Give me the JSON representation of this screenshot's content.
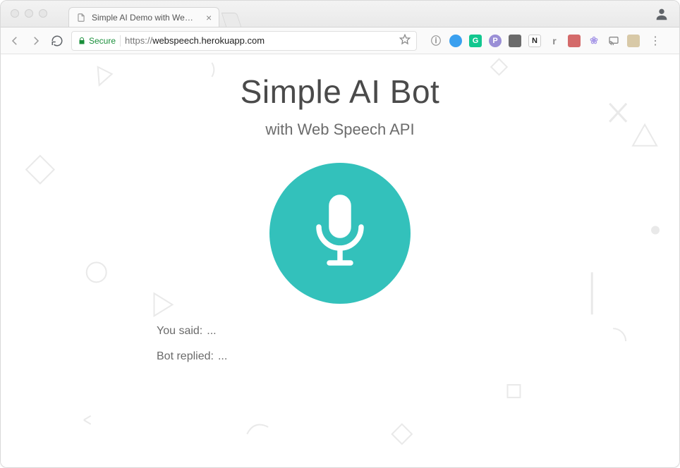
{
  "browser": {
    "tab": {
      "title": "Simple AI Demo with Web Spe"
    },
    "secure_label": "Secure",
    "url": {
      "scheme": "https://",
      "host": "webspeech.herokuapp.com",
      "path": ""
    }
  },
  "page": {
    "title": "Simple AI Bot",
    "subtitle": "with Web Speech API",
    "you_said_label": "You said:",
    "you_said_value": "...",
    "bot_replied_label": "Bot replied:",
    "bot_replied_value": "..."
  },
  "colors": {
    "accent": "#33c1bb",
    "secure_green": "#1a8f3b"
  },
  "ext_icons": [
    {
      "name": "info-icon",
      "bg": "transparent",
      "fg": "#8a8a8a",
      "glyph": "ⓘ"
    },
    {
      "name": "ext-circle-blue",
      "bg": "#3aa0ef",
      "fg": "#fff",
      "glyph": ""
    },
    {
      "name": "ext-grammarly",
      "bg": "#12c78f",
      "fg": "#fff",
      "glyph": "G"
    },
    {
      "name": "ext-circle-purple",
      "bg": "#9a8fd6",
      "fg": "#fff",
      "glyph": "P"
    },
    {
      "name": "ext-gallery",
      "bg": "#6b6b6b",
      "fg": "#fff",
      "glyph": ""
    },
    {
      "name": "ext-notion",
      "bg": "#ffffff",
      "fg": "#222",
      "glyph": "N"
    },
    {
      "name": "ext-letter-r",
      "bg": "transparent",
      "fg": "#8a8a8a",
      "glyph": "r"
    },
    {
      "name": "ext-square-red",
      "bg": "#d46a6a",
      "fg": "#fff",
      "glyph": ""
    },
    {
      "name": "ext-blob",
      "bg": "transparent",
      "fg": "#a99ae8",
      "glyph": "❀"
    },
    {
      "name": "cast-icon",
      "bg": "transparent",
      "fg": "#8a8a8a",
      "glyph": ""
    },
    {
      "name": "ext-square-tan",
      "bg": "#d8c9a7",
      "fg": "#fff",
      "glyph": ""
    }
  ]
}
